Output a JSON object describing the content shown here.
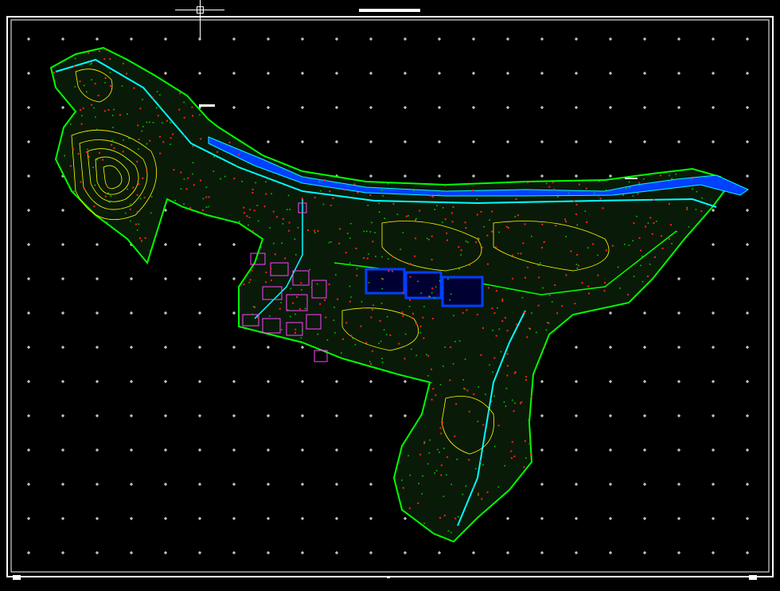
{
  "window": {
    "title": ""
  },
  "drawing": {
    "background": "#000000",
    "frame_color": "#ffffff",
    "grid_color": "#ffffff",
    "layer_colors": {
      "road": "#00ffff",
      "contour": "#ffff00",
      "vegetation": "#00ff00",
      "building": "#ff44ff",
      "water": "#0040ff",
      "points": "#ff2020"
    }
  },
  "labels": {
    "bottom_left_tag": "",
    "bottom_right_tag": ""
  },
  "icons": {
    "crosshair": "crosshair-icon"
  }
}
